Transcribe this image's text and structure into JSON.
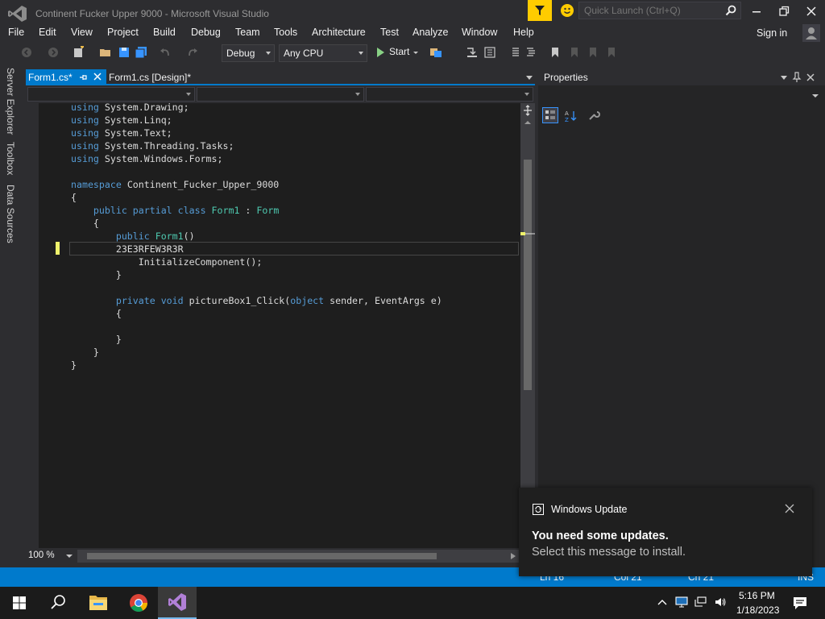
{
  "window": {
    "title": "Continent Fucker Upper 9000 - Microsoft Visual Studio"
  },
  "quick_launch": {
    "placeholder": "Quick Launch (Ctrl+Q)"
  },
  "menu": [
    "File",
    "Edit",
    "View",
    "Project",
    "Build",
    "Debug",
    "Team",
    "Tools",
    "Architecture",
    "Test",
    "Analyze",
    "Window",
    "Help"
  ],
  "account": {
    "sign_in": "Sign in"
  },
  "toolbar": {
    "configuration": "Debug",
    "platform": "Any CPU",
    "start_label": "Start"
  },
  "side_tabs": [
    "Server Explorer",
    "Toolbox",
    "Data Sources"
  ],
  "doc_tabs": {
    "active": "Form1.cs*",
    "inactive": "Form1.cs [Design]*"
  },
  "code": [
    "using System.Drawing;",
    "using System.Linq;",
    "using System.Text;",
    "using System.Threading.Tasks;",
    "using System.Windows.Forms;",
    "",
    "namespace Continent_Fucker_Upper_9000",
    "{",
    "    public partial class Form1 : Form",
    "    {",
    "        public Form1()",
    "        23E3RFEW3R3R",
    "            InitializeComponent();",
    "        }",
    "",
    "        private void pictureBox1_Click(object sender, EventArgs e)",
    "        {",
    "",
    "        }",
    "    }",
    "}"
  ],
  "editor": {
    "zoom": "100 %"
  },
  "properties": {
    "title": "Properties"
  },
  "status": {
    "line": "Ln 16",
    "col": "Col 21",
    "ch": "Ch 21",
    "mode": "INS"
  },
  "toast": {
    "app": "Windows Update",
    "title": "You need some updates.",
    "body": "Select this message to install."
  },
  "clock": {
    "time": "5:16 PM",
    "date": "1/18/2023"
  },
  "colors": {
    "accent": "#007acc",
    "keyword": "#569cd6",
    "type": "#4ec9b0",
    "editor_bg": "#1e1e1e"
  }
}
